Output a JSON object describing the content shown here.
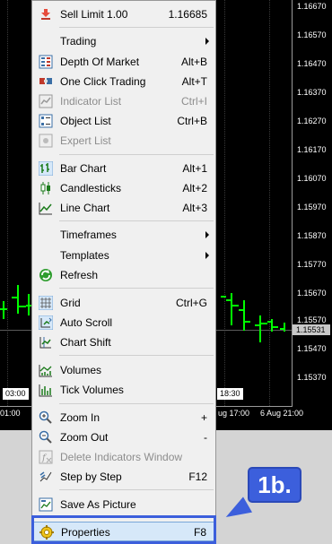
{
  "chart": {
    "price_labels": [
      "1.16670",
      "1.16570",
      "1.16470",
      "1.16370",
      "1.16270",
      "1.16170",
      "1.16070",
      "1.15970",
      "1.15870",
      "1.15770",
      "1.15670",
      "1.15570",
      "1.15470",
      "1.15370"
    ],
    "bid_price": "1.15531",
    "time_labels": [
      "01:00",
      "ug 17:00",
      "6 Aug 21:00"
    ],
    "cursor_time_left": "03:00",
    "cursor_time_right": "18:30",
    "line_color": "#00ff00"
  },
  "menu": {
    "items": [
      {
        "label": "Sell Limit 1.00",
        "shortcut": "1.16685",
        "icon": "sell-limit-arrow-icon"
      },
      {
        "label": "Trading",
        "shortcut": "",
        "submenu": true
      },
      {
        "label": "Depth Of Market",
        "shortcut": "Alt+B",
        "icon": "depth-of-market-icon"
      },
      {
        "label": "One Click Trading",
        "shortcut": "Alt+T",
        "icon": "one-click-trading-icon"
      },
      {
        "label": "Indicator List",
        "shortcut": "Ctrl+I",
        "icon": "indicator-list-icon",
        "disabled": true
      },
      {
        "label": "Object List",
        "shortcut": "Ctrl+B",
        "icon": "object-list-icon"
      },
      {
        "label": "Expert List",
        "shortcut": "",
        "icon": "expert-list-icon",
        "disabled": true
      },
      {
        "label": "Bar Chart",
        "shortcut": "Alt+1",
        "icon": "bar-chart-icon"
      },
      {
        "label": "Candlesticks",
        "shortcut": "Alt+2",
        "icon": "candlesticks-icon"
      },
      {
        "label": "Line Chart",
        "shortcut": "Alt+3",
        "icon": "line-chart-icon"
      },
      {
        "label": "Timeframes",
        "shortcut": "",
        "submenu": true
      },
      {
        "label": "Templates",
        "shortcut": "",
        "submenu": true
      },
      {
        "label": "Refresh",
        "shortcut": "",
        "icon": "refresh-icon"
      },
      {
        "label": "Grid",
        "shortcut": "Ctrl+G",
        "icon": "grid-icon"
      },
      {
        "label": "Auto Scroll",
        "shortcut": "",
        "icon": "auto-scroll-icon"
      },
      {
        "label": "Chart Shift",
        "shortcut": "",
        "icon": "chart-shift-icon"
      },
      {
        "label": "Volumes",
        "shortcut": "",
        "icon": "volumes-icon"
      },
      {
        "label": "Tick Volumes",
        "shortcut": "",
        "icon": "tick-volumes-icon"
      },
      {
        "label": "Zoom In",
        "shortcut": "+",
        "icon": "zoom-in-icon"
      },
      {
        "label": "Zoom Out",
        "shortcut": "-",
        "icon": "zoom-out-icon"
      },
      {
        "label": "Delete Indicators Window",
        "shortcut": "",
        "icon": "delete-indicators-icon",
        "disabled": true
      },
      {
        "label": "Step by Step",
        "shortcut": "F12",
        "icon": "step-by-step-icon"
      },
      {
        "label": "Save As Picture",
        "shortcut": "",
        "icon": "save-as-picture-icon"
      },
      {
        "label": "Properties",
        "shortcut": "F8",
        "icon": "properties-icon"
      }
    ]
  },
  "annotation": {
    "label": "1b.",
    "color": "#3c5fdc"
  }
}
